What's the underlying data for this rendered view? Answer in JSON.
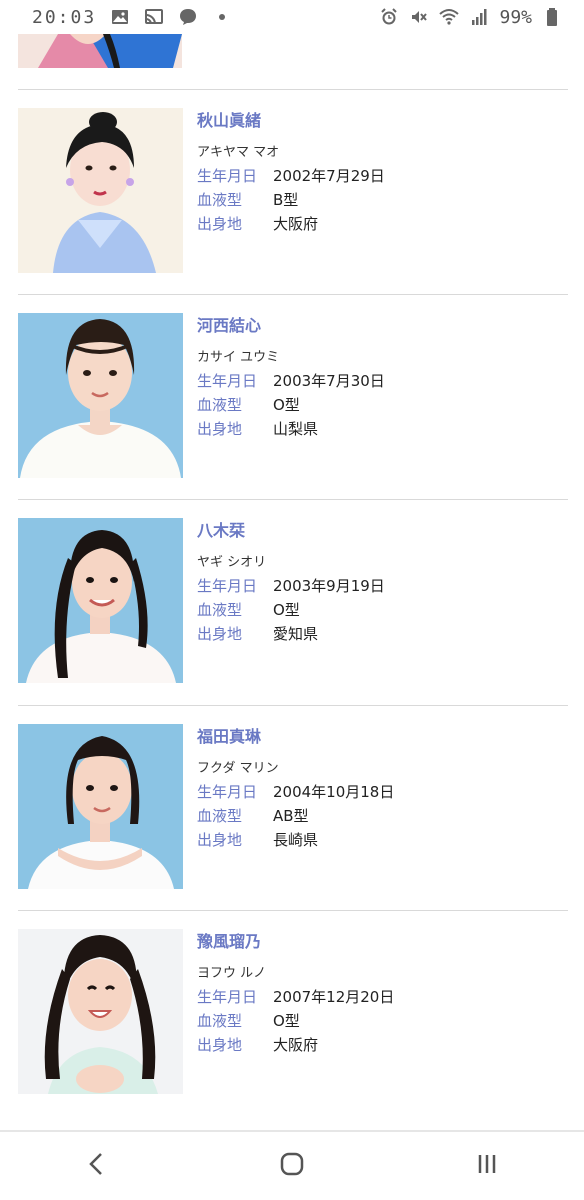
{
  "status": {
    "time": "20:03",
    "battery": "99%",
    "icons_left": [
      "image-icon",
      "cast-icon",
      "chat-icon",
      "dot-icon"
    ],
    "icons_right": [
      "alarm-icon",
      "mute-icon",
      "wifi-icon",
      "signal-icon",
      "battery-icon"
    ]
  },
  "labels": {
    "birthday": "生年月日",
    "blood": "血液型",
    "birthplace": "出身地"
  },
  "members": [
    {
      "name": "秋山眞緒",
      "kana": "アキヤマ マオ",
      "birthday": "2002年7月29日",
      "blood": "B型",
      "birthplace": "大阪府",
      "photo_bg": "#f7f1e6",
      "outfit": "#a9c4f0",
      "hair": "#1a1a1a"
    },
    {
      "name": "河西結心",
      "kana": "カサイ ユウミ",
      "birthday": "2003年7月30日",
      "blood": "O型",
      "birthplace": "山梨県",
      "photo_bg": "#8ec5e6",
      "outfit": "#fbfbf7",
      "hair": "#2a1d16"
    },
    {
      "name": "八木栞",
      "kana": "ヤギ シオリ",
      "birthday": "2003年9月19日",
      "blood": "O型",
      "birthplace": "愛知県",
      "photo_bg": "#8cc4e4",
      "outfit": "#fbf7f5",
      "hair": "#1b1412"
    },
    {
      "name": "福田真琳",
      "kana": "フクダ マリン",
      "birthday": "2004年10月18日",
      "blood": "AB型",
      "birthplace": "長崎県",
      "photo_bg": "#8bc4e4",
      "outfit": "#fbfbfb",
      "hair": "#1f1614"
    },
    {
      "name": "豫風瑠乃",
      "kana": "ヨフウ ルノ",
      "birthday": "2007年12月20日",
      "blood": "O型",
      "birthplace": "大阪府",
      "photo_bg": "#f2f3f5",
      "outfit": "#d9efe8",
      "hair": "#1e1512"
    }
  ],
  "nav": {
    "back": "back-icon",
    "home": "home-icon",
    "recents": "recents-icon"
  }
}
